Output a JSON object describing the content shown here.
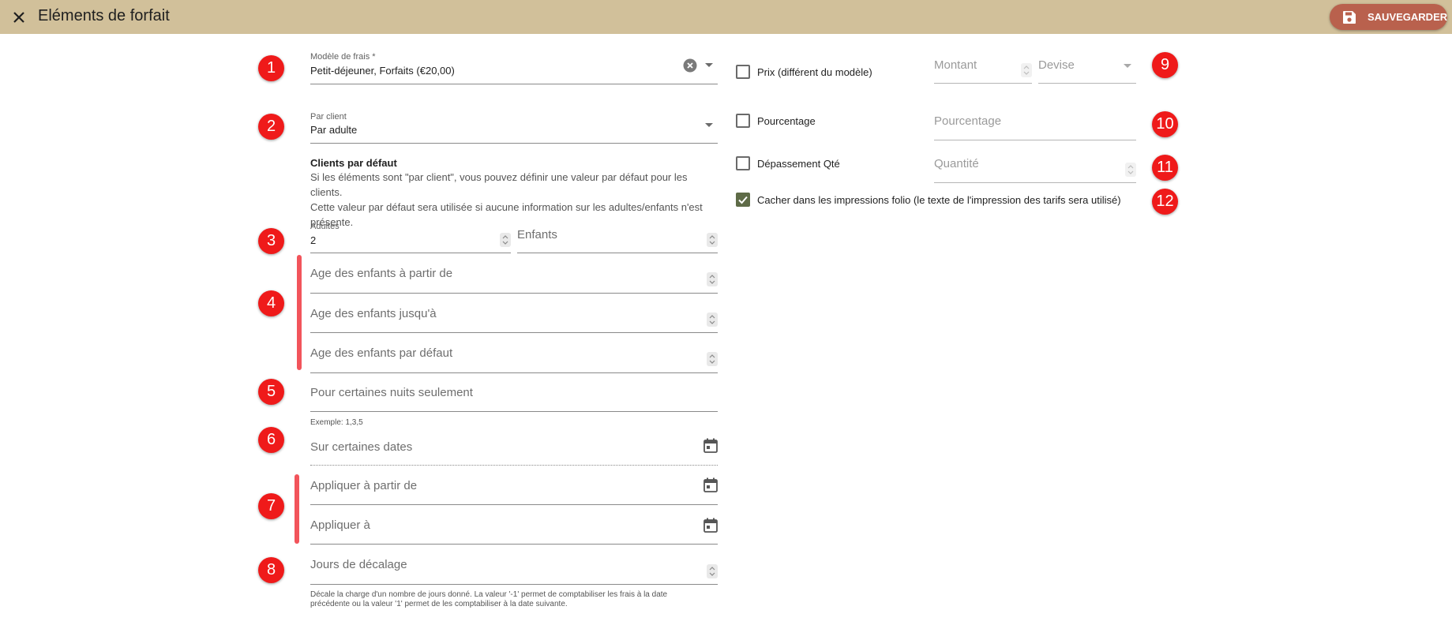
{
  "header": {
    "title": "Eléments de forfait",
    "save_label": "SAUVEGARDER"
  },
  "badges": [
    "1",
    "2",
    "3",
    "4",
    "5",
    "6",
    "7",
    "8",
    "9",
    "10",
    "11",
    "12"
  ],
  "colors": {
    "header_bg": "#d1c09a",
    "save_button": "#b9614d",
    "badge": "#ef1a1a",
    "accent_bar": "#f2545b",
    "checkbox_checked": "#5e6b47"
  },
  "icons": {
    "close": "close-icon",
    "save": "save-icon",
    "clear": "clear-circle-icon",
    "dropdown": "chevron-down-icon",
    "calendar": "calendar-icon",
    "spinner": "spinner-icon",
    "check": "check-icon"
  },
  "fee_model": {
    "label": "Modèle de frais *",
    "value": "Petit-déjeuner, Forfaits (€20,00)"
  },
  "per_client": {
    "label": "Par client",
    "value": "Par adulte"
  },
  "default_clients": {
    "heading": "Clients par défaut",
    "help_line1": "Si les éléments sont \"par client\", vous pouvez définir une valeur par défaut pour les clients.",
    "help_line2": "Cette valeur par défaut sera utilisée si aucune information sur les adultes/enfants n'est",
    "help_line3": "présente."
  },
  "adults": {
    "label": "Adultes",
    "value": "2"
  },
  "children": {
    "placeholder": "Enfants"
  },
  "child_age_from": {
    "placeholder": "Age des enfants à partir de"
  },
  "child_age_to": {
    "placeholder": "Age des enfants jusqu'à"
  },
  "child_age_default": {
    "placeholder": "Age des enfants par défaut"
  },
  "nights": {
    "placeholder": "Pour certaines nuits seulement",
    "hint": "Exemple: 1,3,5"
  },
  "dates": {
    "placeholder": "Sur certaines dates"
  },
  "apply_from": {
    "placeholder": "Appliquer à partir de"
  },
  "apply_to": {
    "placeholder": "Appliquer à"
  },
  "offset_days": {
    "placeholder": "Jours de décalage",
    "hint_line1": "Décale la charge d'un nombre de jours donné. La valeur '-1' permet de comptabiliser les frais à la date",
    "hint_line2": "précédente ou la valeur '1' permet de les comptabiliser à la date suivante."
  },
  "price_override": {
    "label": "Prix (différent du modèle)",
    "checked": false,
    "amount_placeholder": "Montant",
    "currency_placeholder": "Devise"
  },
  "percentage": {
    "label": "Pourcentage",
    "checked": false,
    "placeholder": "Pourcentage"
  },
  "quantity_overrun": {
    "label": "Dépassement Qté",
    "checked": false,
    "placeholder": "Quantité"
  },
  "hide_in_folio": {
    "label": "Cacher dans les impressions folio (le texte de l'impression des tarifs sera utilisé)",
    "checked": true
  }
}
